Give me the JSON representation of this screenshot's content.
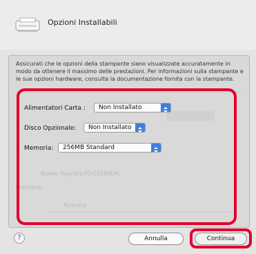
{
  "header": {
    "title": "Opzioni Installabili"
  },
  "description": "Assicurati che le opzioni della stampante siano visualizzate accuratamente in modo da ottenere il massimo delle prestazioni. Per informazioni sulla stampante e le sue opzioni hardware, consulta la documentazione fornita con la stampante.",
  "options": [
    {
      "label": "Alimentatori Carta :",
      "value": "Non Installato"
    },
    {
      "label": "Disco Opzionale:",
      "value": "Non Installato"
    },
    {
      "label": "Memoria:",
      "value": "256MB Standard"
    }
  ],
  "background_ghost": {
    "line1": "Nome: Kyocera FS-C5100DN",
    "line2": "Posizione:",
    "line3": "Kyocera"
  },
  "buttons": {
    "help": "?",
    "cancel": "Annulla",
    "continue": "Continua"
  },
  "colors": {
    "highlight": "#e0002b",
    "popup_arrow": "#3f7fe0"
  }
}
